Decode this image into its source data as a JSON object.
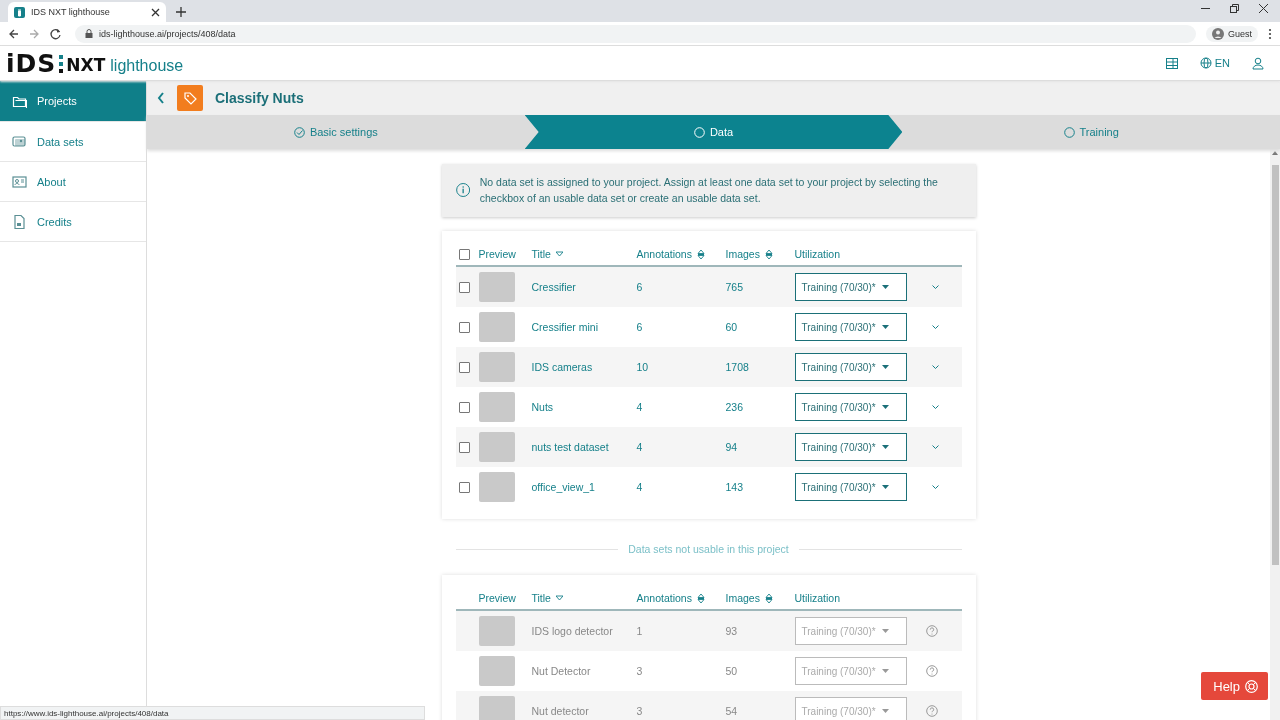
{
  "browser": {
    "tab_title": "IDS NXT lighthouse",
    "url": "ids-lighthouse.ai/projects/408/data",
    "profile": "Guest",
    "status_url": "https://www.ids-lighthouse.ai/projects/408/data"
  },
  "header": {
    "logo": {
      "brand": "iDS",
      "product": "NXT",
      "name": "lighthouse"
    },
    "language": "EN"
  },
  "sidebar": {
    "items": [
      {
        "label": "Projects",
        "selected": true
      },
      {
        "label": "Data sets",
        "selected": false
      },
      {
        "label": "About",
        "selected": false
      },
      {
        "label": "Credits",
        "selected": false
      }
    ]
  },
  "project": {
    "title": "Classify Nuts"
  },
  "steps": [
    {
      "label": "Basic settings",
      "selected": false,
      "done": true
    },
    {
      "label": "Data",
      "selected": true,
      "done": false
    },
    {
      "label": "Training",
      "selected": false,
      "done": false
    }
  ],
  "info": {
    "message": "No data set is assigned to your project. Assign at least one data set to your project by selecting the checkbox of an usable data set or create an usable data set."
  },
  "usable_table": {
    "all_checked": false,
    "columns": [
      {
        "label": "Preview",
        "sortable": false,
        "sorted": false
      },
      {
        "label": "Title",
        "sortable": true,
        "sorted": true
      },
      {
        "label": "Annotations",
        "sortable": true,
        "sorted": false
      },
      {
        "label": "Images",
        "sortable": true,
        "sorted": false
      },
      {
        "label": "Utilization",
        "sortable": false,
        "sorted": false
      }
    ],
    "rows": [
      {
        "title": "Cressifier",
        "annotations": "6",
        "images": "765",
        "utilization": "Training (70/30)*",
        "checked": false,
        "disabled": false
      },
      {
        "title": "Cressifier mini",
        "annotations": "6",
        "images": "60",
        "utilization": "Training (70/30)*",
        "checked": false,
        "disabled": false
      },
      {
        "title": "IDS cameras",
        "annotations": "10",
        "images": "1708",
        "utilization": "Training (70/30)*",
        "checked": false,
        "disabled": false
      },
      {
        "title": "Nuts",
        "annotations": "4",
        "images": "236",
        "utilization": "Training (70/30)*",
        "checked": false,
        "disabled": false
      },
      {
        "title": "nuts test dataset",
        "annotations": "4",
        "images": "94",
        "utilization": "Training (70/30)*",
        "checked": false,
        "disabled": false
      },
      {
        "title": "office_view_1",
        "annotations": "4",
        "images": "143",
        "utilization": "Training (70/30)*",
        "checked": false,
        "disabled": false
      }
    ]
  },
  "divider": {
    "label": "Data sets not usable in this project"
  },
  "unusable_table": {
    "columns": [
      {
        "label": "Preview",
        "sortable": false,
        "sorted": false
      },
      {
        "label": "Title",
        "sortable": true,
        "sorted": true
      },
      {
        "label": "Annotations",
        "sortable": true,
        "sorted": false
      },
      {
        "label": "Images",
        "sortable": true,
        "sorted": false
      },
      {
        "label": "Utilization",
        "sortable": false,
        "sorted": false
      }
    ],
    "rows": [
      {
        "title": "IDS logo detector",
        "annotations": "1",
        "images": "93",
        "utilization": "Training (70/30)*",
        "disabled": true
      },
      {
        "title": "Nut Detector",
        "annotations": "3",
        "images": "50",
        "utilization": "Training (70/30)*",
        "disabled": true
      },
      {
        "title": "Nut detector",
        "annotations": "3",
        "images": "54",
        "utilization": "Training (70/30)*",
        "disabled": true
      }
    ]
  },
  "help": {
    "label": "Help"
  }
}
